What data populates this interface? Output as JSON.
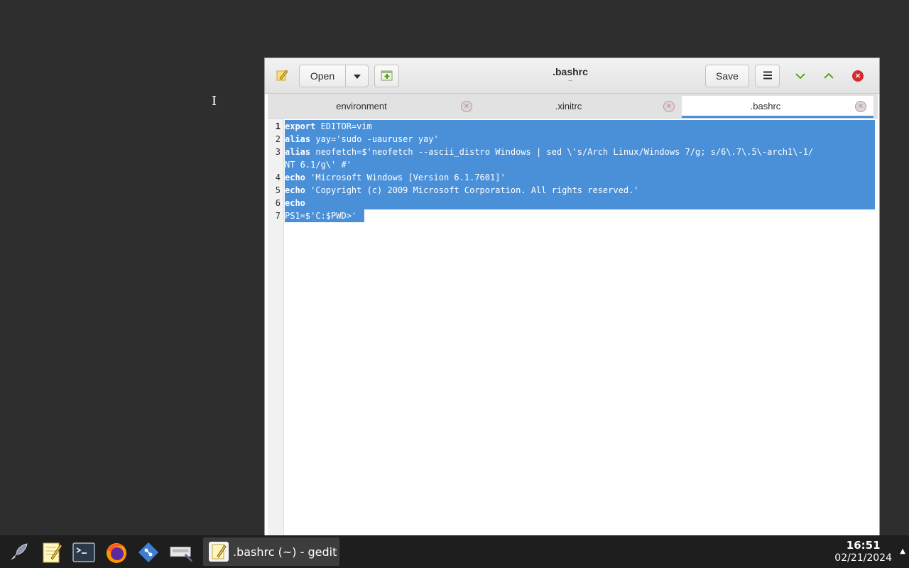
{
  "window": {
    "title": ".bashrc",
    "subtitle": "~",
    "open_label": "Open",
    "save_label": "Save"
  },
  "tabs": [
    {
      "label": "environment",
      "active": false
    },
    {
      "label": ".xinitrc",
      "active": false
    },
    {
      "label": ".bashrc",
      "active": true
    }
  ],
  "editor": {
    "line_numbers": [
      "1",
      "2",
      "3",
      "4",
      "5",
      "6",
      "7"
    ],
    "lines": [
      {
        "keyword": "export",
        "rest": " EDITOR=vim"
      },
      {
        "keyword": "alias",
        "rest": " yay='sudo -uauruser yay'"
      },
      {
        "keyword": "alias",
        "rest": " neofetch=$'neofetch --ascii_distro Windows | sed \\'s/Arch Linux/Windows 7/g; s/6\\.7\\.5\\-arch1\\-1/"
      },
      {
        "keyword": "",
        "rest": "NT 6.1/g\\' #'"
      },
      {
        "keyword": "echo",
        "rest": " 'Microsoft Windows [Version 6.1.7601]'"
      },
      {
        "keyword": "echo",
        "rest": " 'Copyright (c) 2009 Microsoft Corporation. All rights reserved.'"
      },
      {
        "keyword": "echo",
        "rest": ""
      },
      {
        "keyword": "",
        "rest": "PS1=$'C:$PWD>'"
      }
    ],
    "selection_color": "#4a90d9"
  },
  "taskbar": {
    "launchers": [
      "rocket-icon",
      "text-editor-icon",
      "terminal-icon",
      "firefox-icon",
      "git-icon",
      "screenshot-icon"
    ],
    "active_task_label": ".bashrc (~) - gedit",
    "clock_time": "16:51",
    "clock_date": "02/21/2024"
  },
  "colors": {
    "desktop": "#2e2e2e",
    "taskbar": "#1e1e1e",
    "accent": "#4a90d9",
    "close": "#d52b2b",
    "window_control": "#4e9a06"
  }
}
